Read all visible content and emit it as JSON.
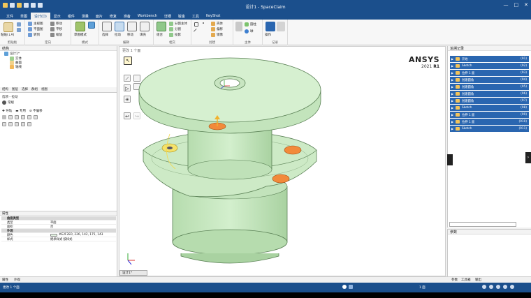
{
  "window": {
    "title": "设计1 - SpaceClaim",
    "minimize": "—",
    "maximize": "□",
    "close": "✕"
  },
  "menu_tabs": [
    "文件",
    "草图",
    "设计(D)",
    "显示",
    "组件",
    "测量",
    "面片",
    "修复",
    "准备",
    "Workbench",
    "详细",
    "钣金",
    "工具",
    "KeyShot"
  ],
  "active_tab_index": 2,
  "ribbon": {
    "groups": [
      "剪贴板",
      "定向",
      "模式",
      "编辑",
      "相交",
      "创建",
      "主体",
      "记录"
    ],
    "paste_label": "粘贴(↓A)",
    "orient_items": [
      "主视图",
      "平面图",
      "转到",
      "移动",
      "平移",
      "缩放"
    ],
    "mode_label": "草图模式",
    "edit_items": [
      "选择",
      "拉动",
      "移动",
      "填充"
    ],
    "intersect_items": [
      "组合",
      "分割主体",
      "分割",
      "投影"
    ],
    "create_items": [
      "壳体",
      "偏移",
      "镜像"
    ],
    "body_items": [
      "圆柱",
      "球"
    ],
    "record_label": "操作"
  },
  "structure_panel": {
    "title": "结构",
    "items": [
      {
        "label": "设计1*",
        "level": 0
      },
      {
        "label": "实体",
        "level": 1
      },
      {
        "label": "曲面",
        "level": 1
      },
      {
        "label": "轴线",
        "level": 1
      }
    ],
    "tabs": [
      "结构",
      "图层",
      "选择",
      "群组",
      "视图"
    ],
    "options_title": "选项 - 拉动",
    "options_sub": "常规",
    "options_row": [
      "导轨",
      "专用",
      "不偏移"
    ]
  },
  "properties_panel": {
    "title": "属性",
    "rows": [
      {
        "key": "曲面类型",
        "value": "",
        "group": true
      },
      {
        "key": "类型",
        "value": "平面",
        "group": false
      },
      {
        "key": "面积",
        "value": "否",
        "group": false
      },
      {
        "key": "外观",
        "value": "",
        "group": true
      },
      {
        "key": "颜色",
        "value": "#E2F2E0, 226, 142, 175, 143",
        "group": false
      },
      {
        "key": "样式",
        "value": "继承样式 按样式",
        "group": false
      }
    ],
    "tabs": [
      "属性",
      "外观"
    ]
  },
  "viewport": {
    "caption": "更改 1 个面",
    "brand": "ANSYS",
    "version": "2021",
    "release": "R1",
    "doc_tab": "设计1*"
  },
  "history_panel": {
    "title": "追溯记录",
    "entries": [
      {
        "label": "开始",
        "num": "(91)"
      },
      {
        "label": "Sketch",
        "num": "(92)"
      },
      {
        "label": "拉伸 1 面",
        "num": "(93)"
      },
      {
        "label": "创建圆角",
        "num": "(94)"
      },
      {
        "label": "创建圆角",
        "num": "(95)"
      },
      {
        "label": "创建圆角",
        "num": "(96)"
      },
      {
        "label": "创建圆角",
        "num": "(97)"
      },
      {
        "label": "Sketch",
        "num": "(98)"
      },
      {
        "label": "拉伸 1 面",
        "num": "(99)"
      },
      {
        "label": "拉伸 1 面",
        "num": "(910)"
      },
      {
        "label": "Sketch",
        "num": "(911)"
      }
    ]
  },
  "params_panel": {
    "title": "参数",
    "tabs": [
      "参数",
      "工具箱",
      "输出"
    ]
  },
  "status": {
    "left": "更改 1 个面",
    "center": "1 面"
  },
  "colors": {
    "title_bar": "#1b4f8c",
    "model_green": "#c8e8c2",
    "highlight_orange": "#f28a3a",
    "history_blue": "#2a66b0"
  }
}
